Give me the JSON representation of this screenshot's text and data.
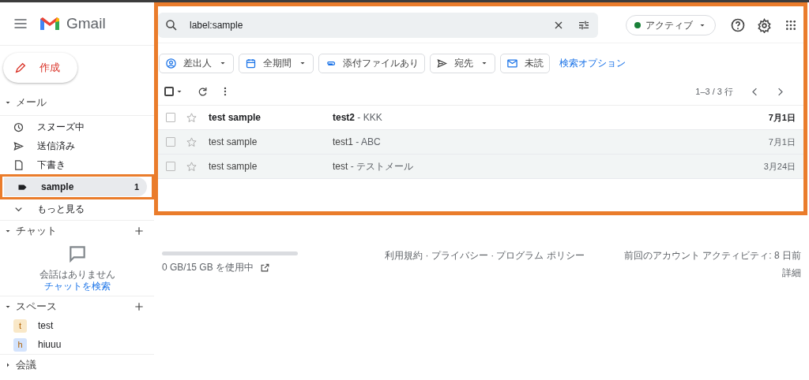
{
  "app": {
    "name": "Gmail"
  },
  "compose": {
    "label": "作成"
  },
  "sidebar": {
    "mail": {
      "title": "メール",
      "expanded": true,
      "items": [
        {
          "label": "スヌーズ中",
          "selected": false,
          "highlighted": false
        },
        {
          "label": "送信済み",
          "selected": false,
          "highlighted": false
        },
        {
          "label": "下書き",
          "selected": false,
          "highlighted": false
        },
        {
          "label": "sample",
          "count": "1",
          "selected": true,
          "highlighted": true
        },
        {
          "label": "もっと見る",
          "selected": false,
          "highlighted": false
        }
      ]
    },
    "chat": {
      "title": "チャット",
      "expanded": true,
      "empty_text": "会話はありません",
      "link": "チャットを検索"
    },
    "spaces": {
      "title": "スペース",
      "expanded": true,
      "items": [
        {
          "initial": "t",
          "name": "test",
          "color": "#f9e8c8"
        },
        {
          "initial": "h",
          "name": "hiuuu",
          "color": "#d3e3fd"
        }
      ]
    },
    "meetings": {
      "title": "会議",
      "expanded": false
    }
  },
  "search": {
    "value": "label:sample"
  },
  "status": {
    "label": "アクティブ"
  },
  "filters": [
    {
      "label": "差出人",
      "dropdown": true
    },
    {
      "label": "全期間",
      "dropdown": true
    },
    {
      "label": "添付ファイルあり",
      "dropdown": false
    },
    {
      "label": "宛先",
      "dropdown": true
    },
    {
      "label": "未読",
      "dropdown": false
    }
  ],
  "advanced_search": "検索オプション",
  "select_all": {
    "checked": false
  },
  "pagination": "1–3 / 3 行",
  "emails": [
    {
      "sender": "test sample",
      "subject": "test2",
      "snippet": "- KKK",
      "date": "7月1日",
      "unread": true,
      "starred": false,
      "checked": false
    },
    {
      "sender": "test sample",
      "subject": "test1",
      "snippet": "- ABC",
      "date": "7月1日",
      "unread": false,
      "starred": false,
      "checked": false
    },
    {
      "sender": "test sample",
      "subject": "test",
      "snippet": "- テストメール",
      "date": "3月24日",
      "unread": false,
      "starred": false,
      "checked": false
    }
  ],
  "footer": {
    "storage": {
      "level": 0,
      "text": "0 GB/15 GB を使用中"
    },
    "links": "利用規約 · プライバシー · プログラム ポリシー",
    "activity": "前回のアカウント アクティビティ: 8 日前",
    "details": "詳細"
  }
}
